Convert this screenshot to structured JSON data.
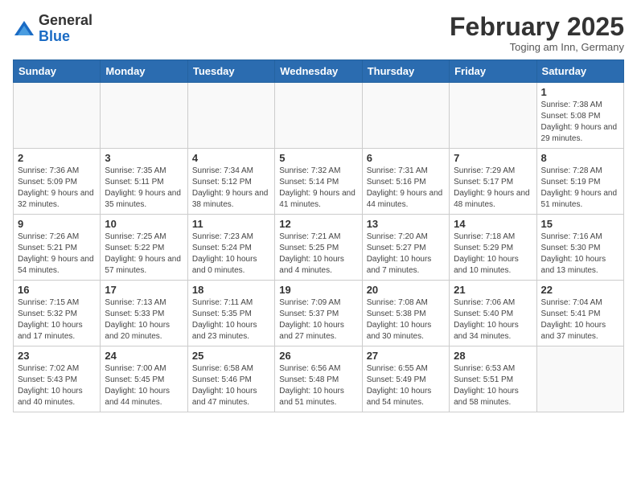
{
  "logo": {
    "general": "General",
    "blue": "Blue"
  },
  "header": {
    "month": "February 2025",
    "location": "Toging am Inn, Germany"
  },
  "weekdays": [
    "Sunday",
    "Monday",
    "Tuesday",
    "Wednesday",
    "Thursday",
    "Friday",
    "Saturday"
  ],
  "weeks": [
    [
      {
        "day": "",
        "info": ""
      },
      {
        "day": "",
        "info": ""
      },
      {
        "day": "",
        "info": ""
      },
      {
        "day": "",
        "info": ""
      },
      {
        "day": "",
        "info": ""
      },
      {
        "day": "",
        "info": ""
      },
      {
        "day": "1",
        "info": "Sunrise: 7:38 AM\nSunset: 5:08 PM\nDaylight: 9 hours and 29 minutes."
      }
    ],
    [
      {
        "day": "2",
        "info": "Sunrise: 7:36 AM\nSunset: 5:09 PM\nDaylight: 9 hours and 32 minutes."
      },
      {
        "day": "3",
        "info": "Sunrise: 7:35 AM\nSunset: 5:11 PM\nDaylight: 9 hours and 35 minutes."
      },
      {
        "day": "4",
        "info": "Sunrise: 7:34 AM\nSunset: 5:12 PM\nDaylight: 9 hours and 38 minutes."
      },
      {
        "day": "5",
        "info": "Sunrise: 7:32 AM\nSunset: 5:14 PM\nDaylight: 9 hours and 41 minutes."
      },
      {
        "day": "6",
        "info": "Sunrise: 7:31 AM\nSunset: 5:16 PM\nDaylight: 9 hours and 44 minutes."
      },
      {
        "day": "7",
        "info": "Sunrise: 7:29 AM\nSunset: 5:17 PM\nDaylight: 9 hours and 48 minutes."
      },
      {
        "day": "8",
        "info": "Sunrise: 7:28 AM\nSunset: 5:19 PM\nDaylight: 9 hours and 51 minutes."
      }
    ],
    [
      {
        "day": "9",
        "info": "Sunrise: 7:26 AM\nSunset: 5:21 PM\nDaylight: 9 hours and 54 minutes."
      },
      {
        "day": "10",
        "info": "Sunrise: 7:25 AM\nSunset: 5:22 PM\nDaylight: 9 hours and 57 minutes."
      },
      {
        "day": "11",
        "info": "Sunrise: 7:23 AM\nSunset: 5:24 PM\nDaylight: 10 hours and 0 minutes."
      },
      {
        "day": "12",
        "info": "Sunrise: 7:21 AM\nSunset: 5:25 PM\nDaylight: 10 hours and 4 minutes."
      },
      {
        "day": "13",
        "info": "Sunrise: 7:20 AM\nSunset: 5:27 PM\nDaylight: 10 hours and 7 minutes."
      },
      {
        "day": "14",
        "info": "Sunrise: 7:18 AM\nSunset: 5:29 PM\nDaylight: 10 hours and 10 minutes."
      },
      {
        "day": "15",
        "info": "Sunrise: 7:16 AM\nSunset: 5:30 PM\nDaylight: 10 hours and 13 minutes."
      }
    ],
    [
      {
        "day": "16",
        "info": "Sunrise: 7:15 AM\nSunset: 5:32 PM\nDaylight: 10 hours and 17 minutes."
      },
      {
        "day": "17",
        "info": "Sunrise: 7:13 AM\nSunset: 5:33 PM\nDaylight: 10 hours and 20 minutes."
      },
      {
        "day": "18",
        "info": "Sunrise: 7:11 AM\nSunset: 5:35 PM\nDaylight: 10 hours and 23 minutes."
      },
      {
        "day": "19",
        "info": "Sunrise: 7:09 AM\nSunset: 5:37 PM\nDaylight: 10 hours and 27 minutes."
      },
      {
        "day": "20",
        "info": "Sunrise: 7:08 AM\nSunset: 5:38 PM\nDaylight: 10 hours and 30 minutes."
      },
      {
        "day": "21",
        "info": "Sunrise: 7:06 AM\nSunset: 5:40 PM\nDaylight: 10 hours and 34 minutes."
      },
      {
        "day": "22",
        "info": "Sunrise: 7:04 AM\nSunset: 5:41 PM\nDaylight: 10 hours and 37 minutes."
      }
    ],
    [
      {
        "day": "23",
        "info": "Sunrise: 7:02 AM\nSunset: 5:43 PM\nDaylight: 10 hours and 40 minutes."
      },
      {
        "day": "24",
        "info": "Sunrise: 7:00 AM\nSunset: 5:45 PM\nDaylight: 10 hours and 44 minutes."
      },
      {
        "day": "25",
        "info": "Sunrise: 6:58 AM\nSunset: 5:46 PM\nDaylight: 10 hours and 47 minutes."
      },
      {
        "day": "26",
        "info": "Sunrise: 6:56 AM\nSunset: 5:48 PM\nDaylight: 10 hours and 51 minutes."
      },
      {
        "day": "27",
        "info": "Sunrise: 6:55 AM\nSunset: 5:49 PM\nDaylight: 10 hours and 54 minutes."
      },
      {
        "day": "28",
        "info": "Sunrise: 6:53 AM\nSunset: 5:51 PM\nDaylight: 10 hours and 58 minutes."
      },
      {
        "day": "",
        "info": ""
      }
    ]
  ]
}
